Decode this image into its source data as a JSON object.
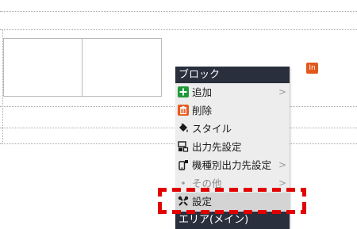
{
  "badge": {
    "text": "In"
  },
  "menu": {
    "header": "ブロック",
    "items": [
      {
        "label": "追加",
        "icon": "plus-icon",
        "arrow": ">"
      },
      {
        "label": "削除",
        "icon": "trash-icon",
        "arrow": ""
      },
      {
        "label": "スタイル",
        "icon": "paint-bucket-icon",
        "arrow": ""
      },
      {
        "label": "出力先設定",
        "icon": "output-target-icon",
        "arrow": ""
      },
      {
        "label": "機種別出力先設定",
        "icon": "mobile-device-icon",
        "arrow": ">"
      },
      {
        "label": "その他",
        "icon": "bullet-icon",
        "arrow": ">"
      },
      {
        "label": "設定",
        "icon": "wrench-icon",
        "arrow": ""
      }
    ],
    "footer_header": "エリア(メイン)"
  },
  "colors": {
    "menu_header_bg": "#292f3d",
    "menu_bg": "#ededed",
    "highlight_bg": "#d4d4d4",
    "badge_bg": "#e2571b",
    "callout_red": "#e30000",
    "plus_green": "#1f9a3a",
    "trash_orange": "#e85a1e"
  }
}
